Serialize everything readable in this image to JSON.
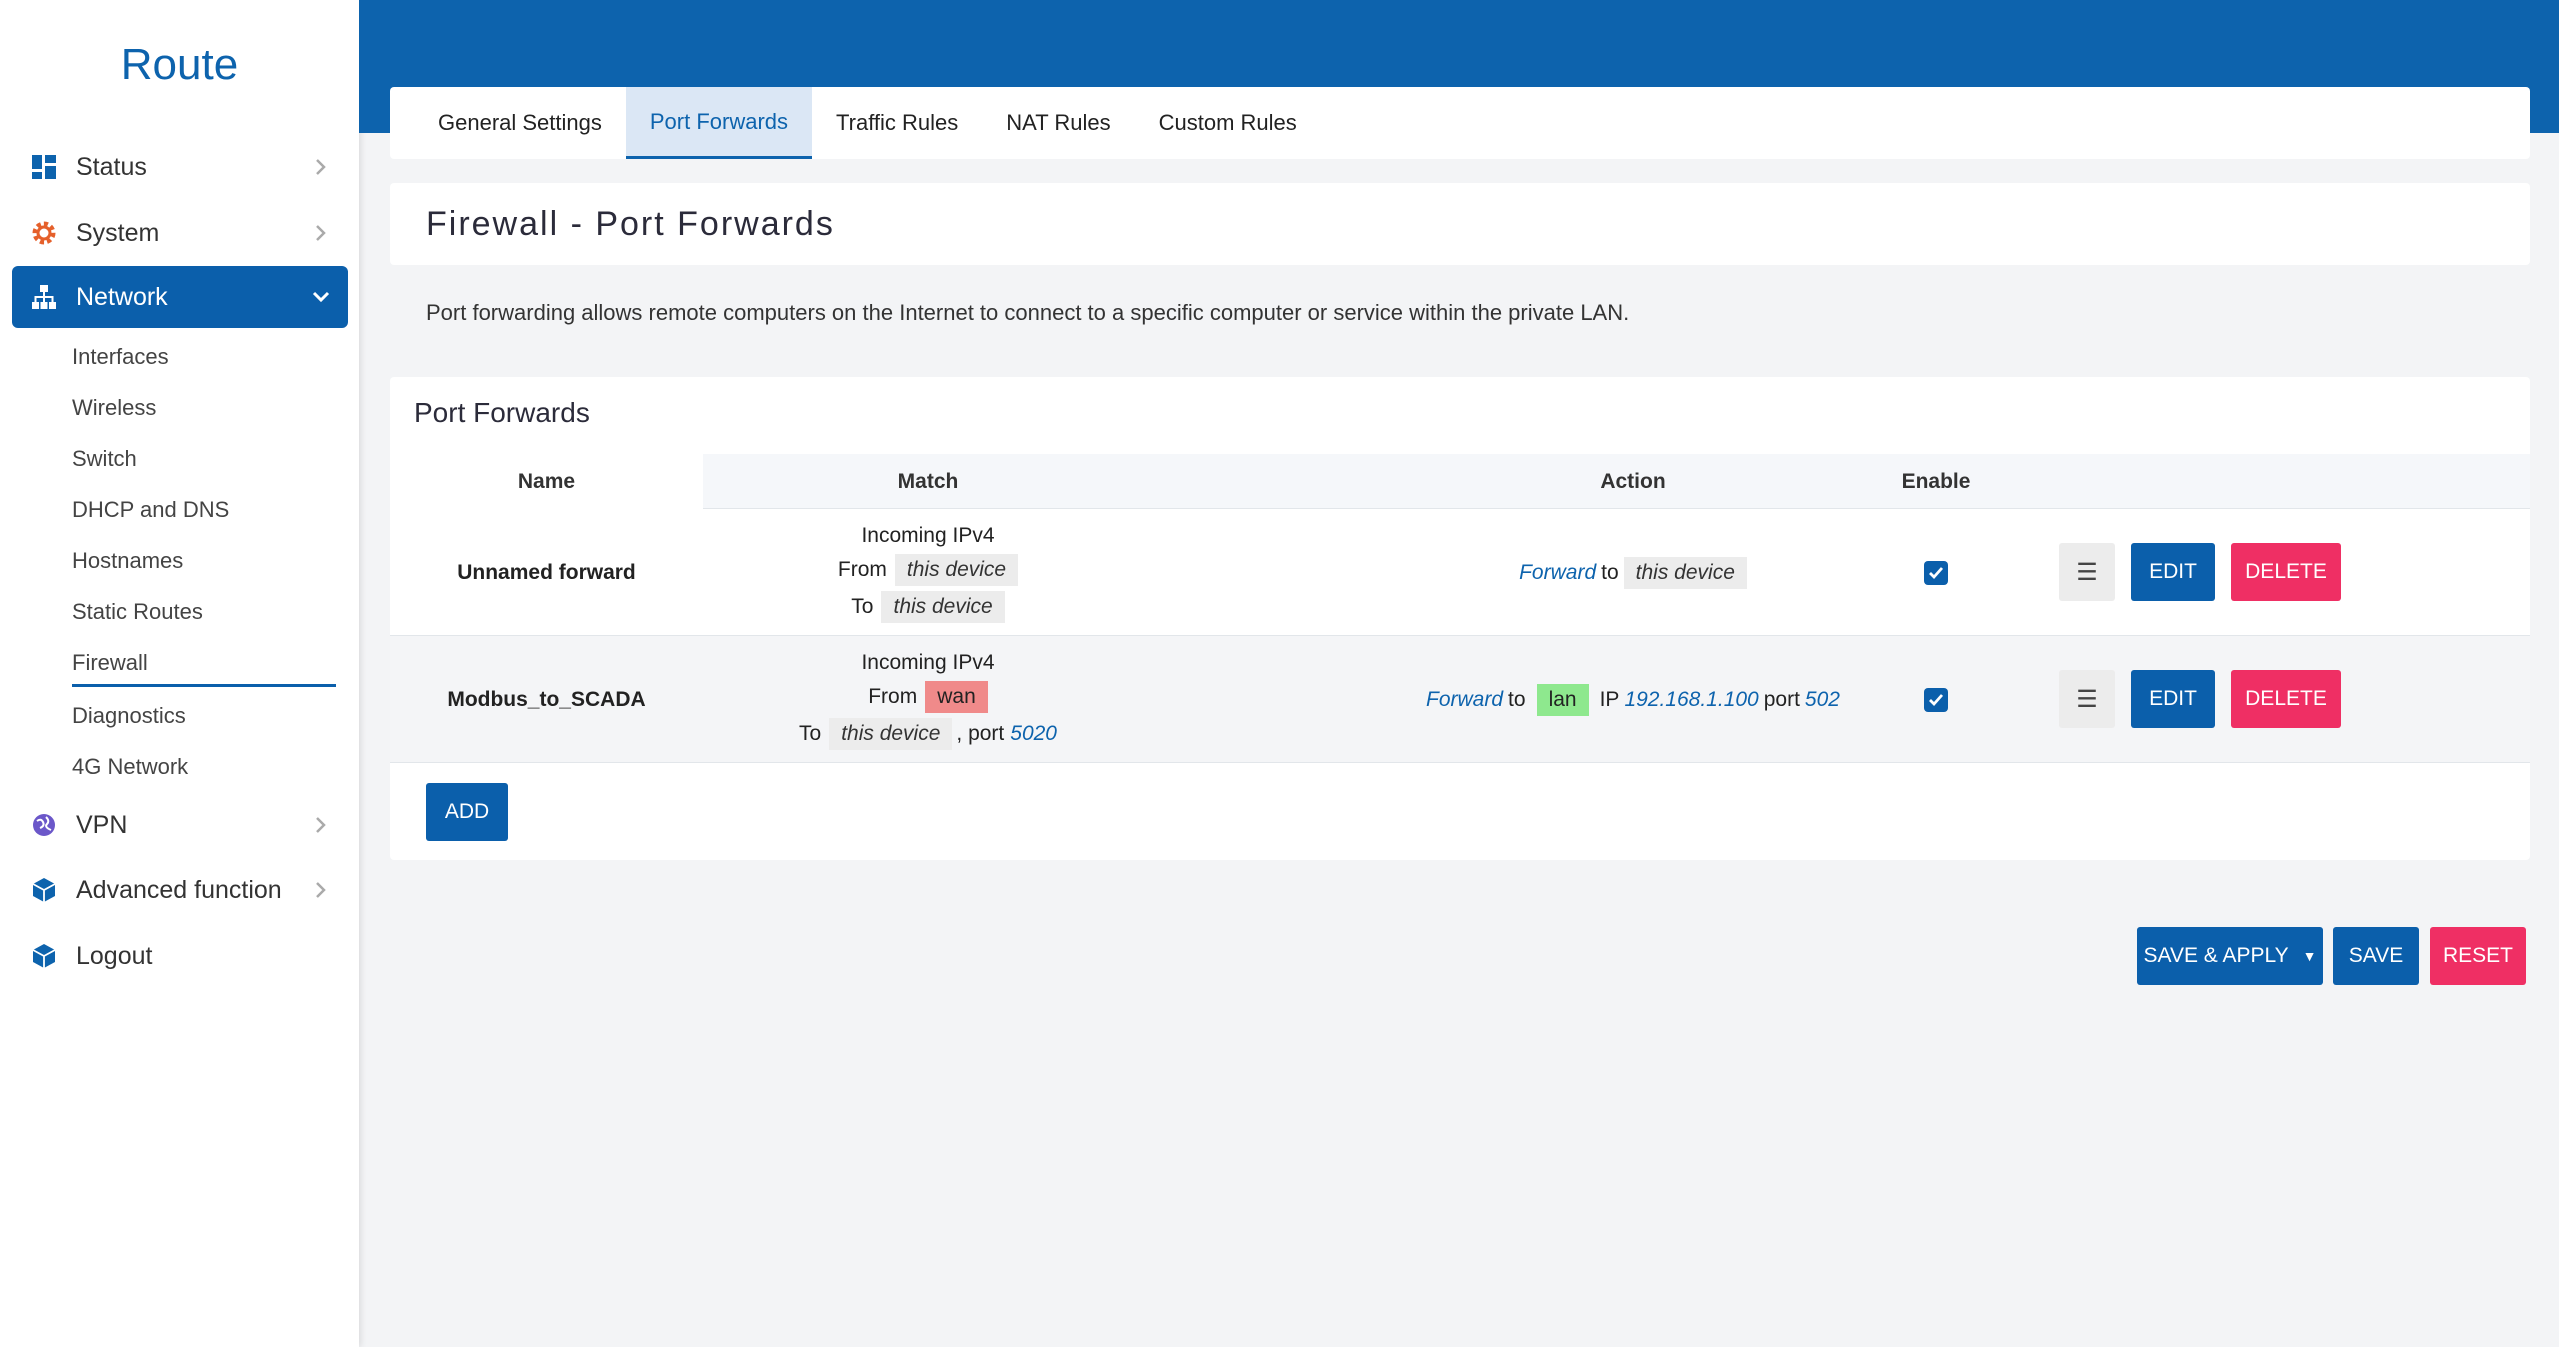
{
  "brand": "Route",
  "nav": [
    {
      "label": "Status",
      "icon": "dashboard-icon",
      "color": "#0d63ad"
    },
    {
      "label": "System",
      "icon": "gear-icon",
      "color": "#e5602b"
    },
    {
      "label": "Network",
      "icon": "network-icon",
      "color": "#ffffff"
    },
    {
      "label": "VPN",
      "icon": "globe-icon",
      "color": "#6b57c9"
    },
    {
      "label": "Advanced function",
      "icon": "cube-icon",
      "color": "#0d63ad"
    },
    {
      "label": "Logout",
      "icon": "cube-icon",
      "color": "#0d63ad"
    }
  ],
  "network_sub": [
    "Interfaces",
    "Wireless",
    "Switch",
    "DHCP and DNS",
    "Hostnames",
    "Static Routes",
    "Firewall",
    "Diagnostics",
    "4G Network"
  ],
  "tabs": [
    "General Settings",
    "Port Forwards",
    "Traffic Rules",
    "NAT Rules",
    "Custom Rules"
  ],
  "active_tab": "Port Forwards",
  "page_title": "Firewall - Port Forwards",
  "description": "Port forwarding allows remote computers on the Internet to connect to a specific computer or service within the private LAN.",
  "table": {
    "title": "Port Forwards",
    "headers": {
      "name": "Name",
      "match": "Match",
      "action": "Action",
      "enable": "Enable"
    },
    "rows": [
      {
        "name": "Unnamed forward",
        "match_line1": "Incoming IPv4",
        "from_label": "From",
        "from_value": "this device",
        "to_label": "To",
        "to_value": "this device",
        "action_forward": "Forward",
        "action_to": "to",
        "action_target": "this device",
        "enabled": true
      },
      {
        "name": "Modbus_to_SCADA",
        "match_line1": "Incoming IPv4",
        "from_label": "From",
        "from_value": "wan",
        "to_label": "To",
        "to_value": "this device",
        "to_port_label": ", port",
        "to_port": "5020",
        "action_forward": "Forward",
        "action_to": "to",
        "action_zone": "lan",
        "action_ip_label": "IP",
        "action_ip": "192.168.1.100",
        "action_port_label": "port",
        "action_port": "502",
        "enabled": true
      }
    ],
    "handle_label": "☰",
    "edit_label": "EDIT",
    "delete_label": "DELETE",
    "add_label": "ADD"
  },
  "footer": {
    "save_apply": "SAVE & APPLY",
    "save": "SAVE",
    "reset": "RESET"
  },
  "colors": {
    "primary": "#0d63ad",
    "danger": "#ef2f64",
    "wan": "#f08a8a",
    "lan": "#8ee88e"
  }
}
